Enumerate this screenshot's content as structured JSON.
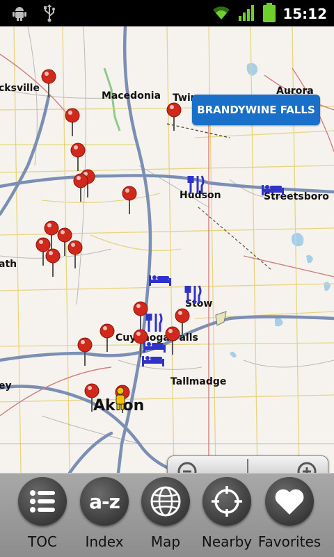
{
  "status_bar": {
    "time": "15:12",
    "icons": [
      "android-debug-icon",
      "usb-icon",
      "wifi-icon",
      "signal-icon",
      "battery-icon"
    ]
  },
  "map": {
    "callout_label": "BRANDYWINE FALLS",
    "towns": {
      "sksville": "cksville",
      "macedonia": "Macedonia",
      "twin": "Twin",
      "aurora": "Aurora",
      "hudson": "Hudson",
      "streetsboro": "Streetsboro",
      "ath": "ath",
      "stow": "Stow",
      "cuyahoga": "Cuyahoga Falls",
      "tallmadge": "Tallmadge",
      "ey": "ey",
      "akron": "Akron"
    }
  },
  "zoom": {
    "out_icon": "zoom-out-icon",
    "in_icon": "zoom-in-icon"
  },
  "bottom_nav": {
    "toc": "TOC",
    "index": "Index",
    "index_icon_text": "a-z",
    "map": "Map",
    "nearby": "Nearby",
    "favorites": "Favorites"
  },
  "colors": {
    "map_background": "#f6f3ee",
    "callout": "#1a6fc8",
    "highway": "#7b8fb4",
    "water": "#a8cfe8",
    "poi_pin": "#d0281b",
    "poi_blue": "#2f33c9"
  }
}
